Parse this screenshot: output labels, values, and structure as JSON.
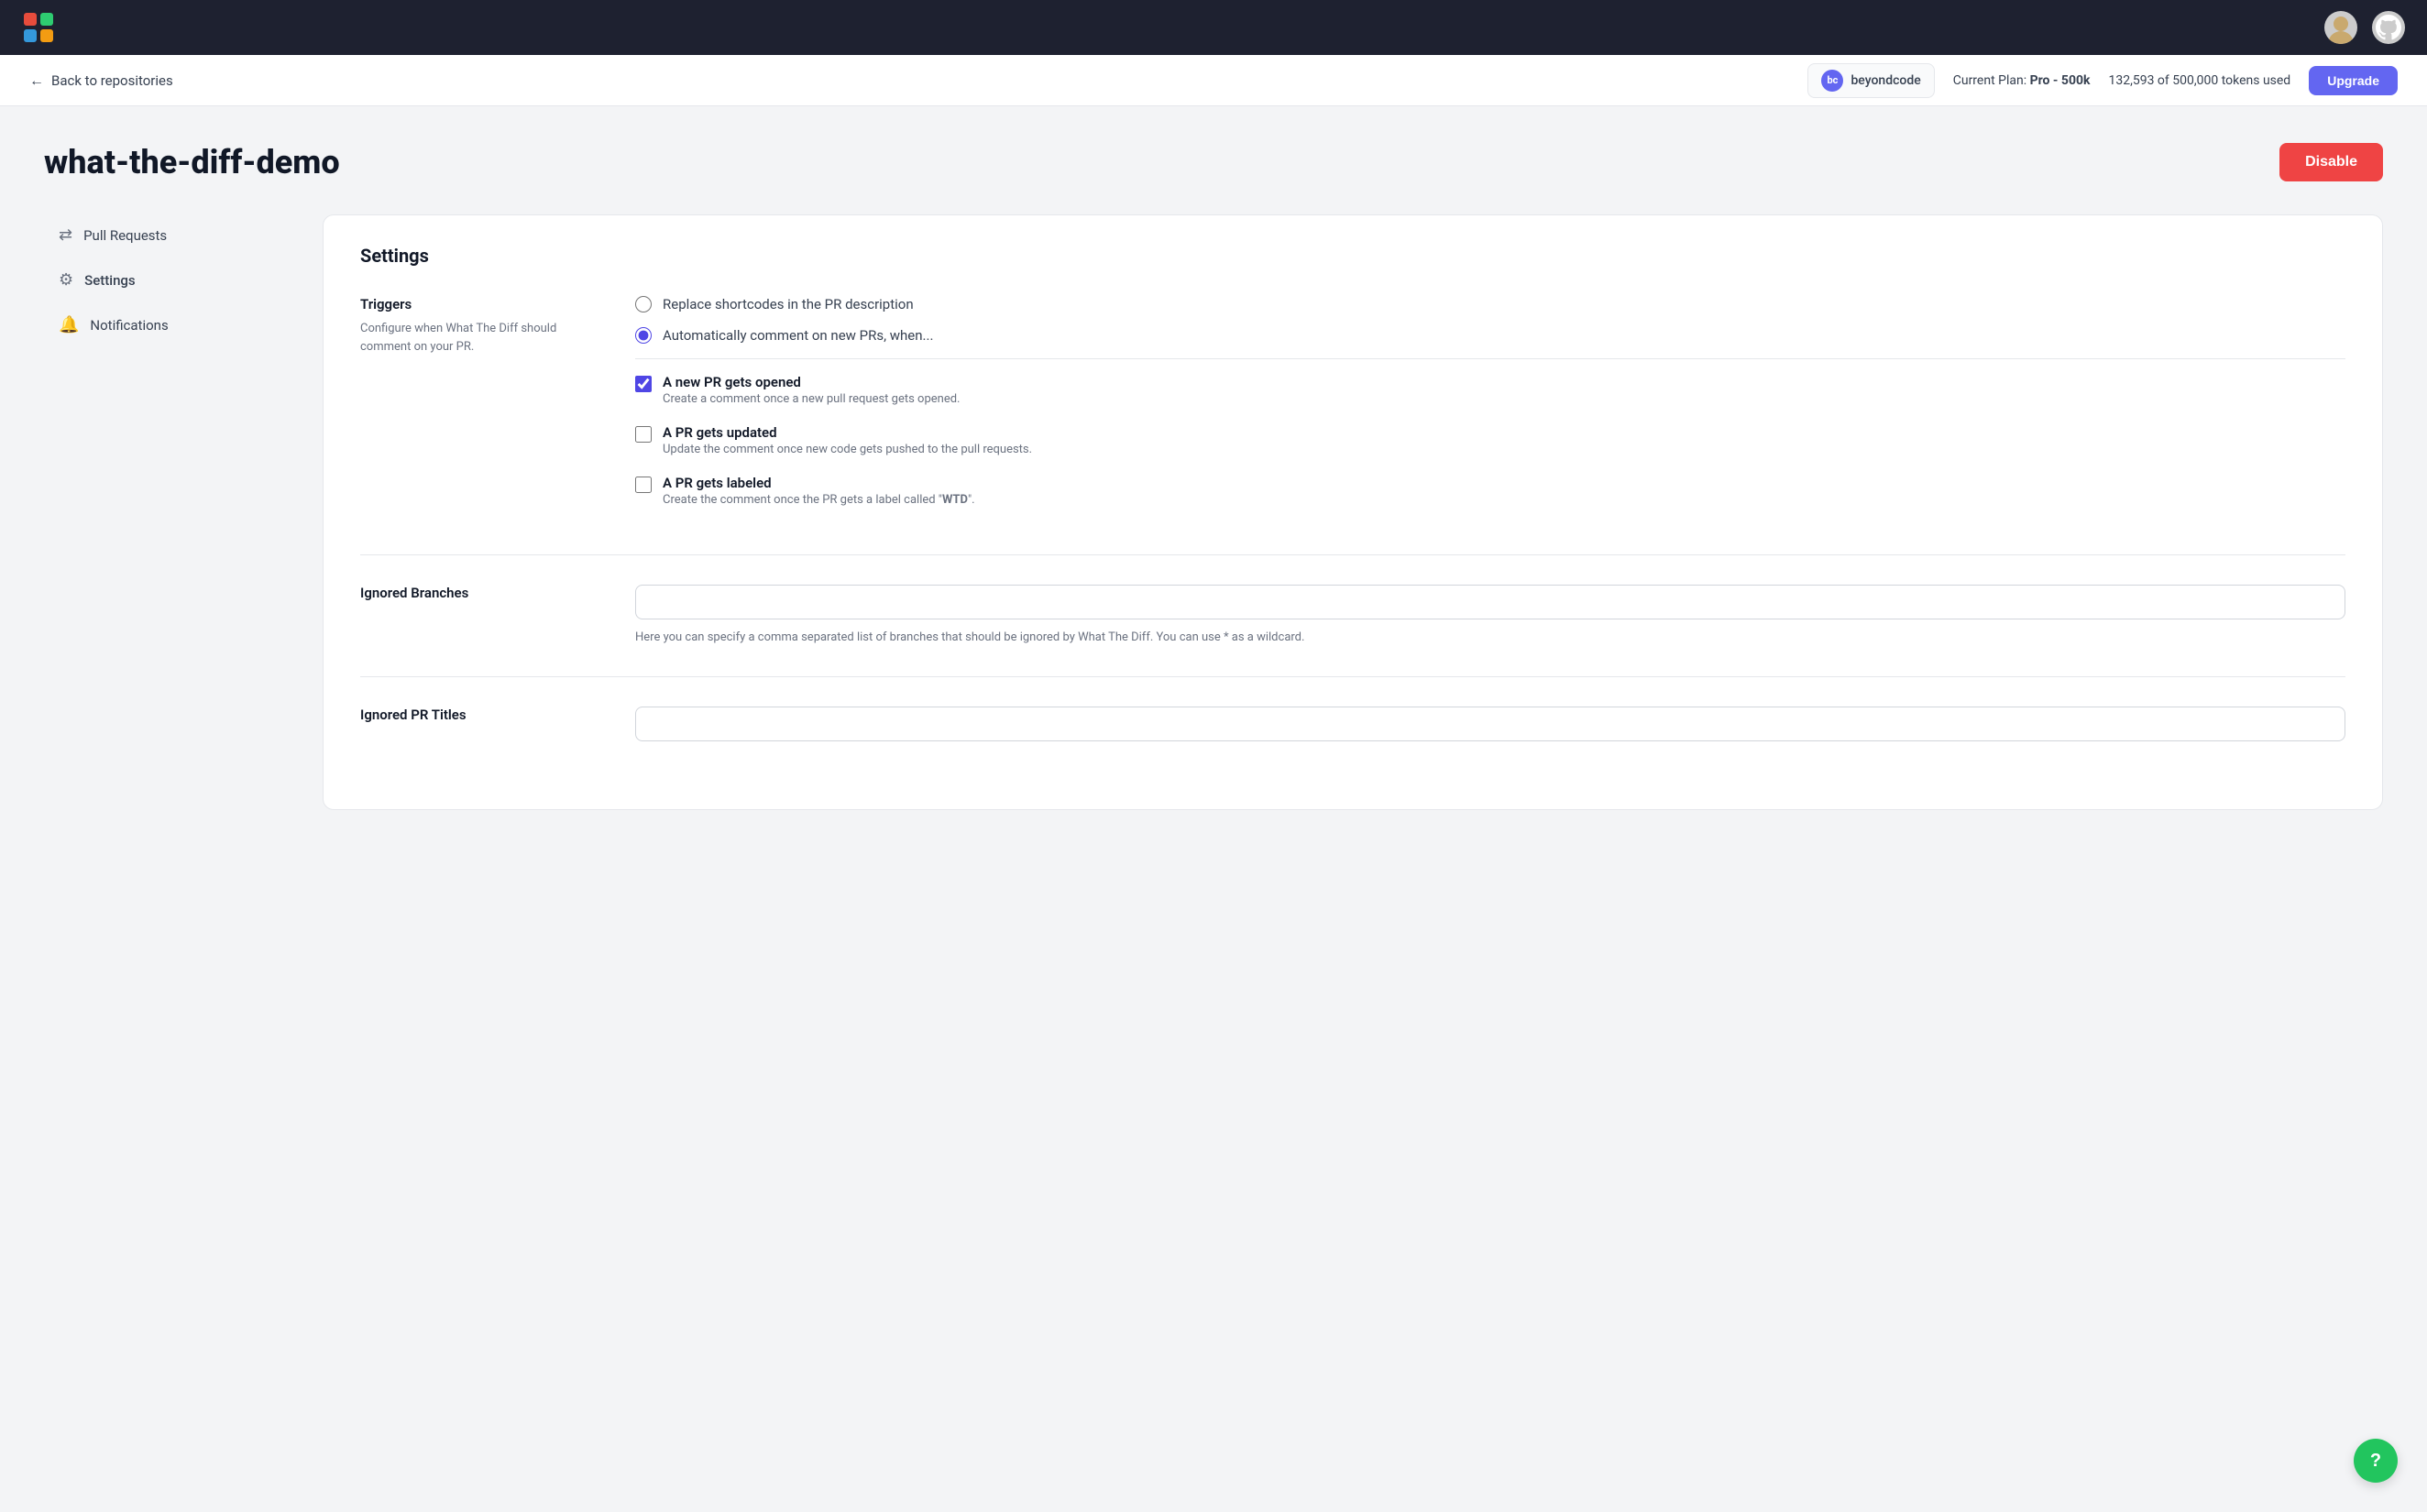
{
  "topbar": {
    "logo_alt": "App Logo"
  },
  "subheader": {
    "back_label": "Back to repositories",
    "org_name": "beyondcode",
    "org_initials": "bc",
    "plan_label": "Current Plan:",
    "plan_name": "Pro - 500k",
    "tokens_used": "132,593 of 500,000 tokens used",
    "upgrade_label": "Upgrade"
  },
  "page": {
    "title": "what-the-diff-demo",
    "disable_label": "Disable"
  },
  "sidebar": {
    "items": [
      {
        "label": "Pull Requests",
        "icon": "⇅",
        "active": false
      },
      {
        "label": "Settings",
        "icon": "⚙",
        "active": true
      },
      {
        "label": "Notifications",
        "icon": "🔔",
        "active": false
      }
    ]
  },
  "settings": {
    "title": "Settings",
    "triggers": {
      "label": "Triggers",
      "description": "Configure when What The Diff should comment on your PR.",
      "option1": {
        "label": "Replace shortcodes in the PR description",
        "checked": false
      },
      "option2": {
        "label": "Automatically comment on new PRs, when...",
        "checked": true
      },
      "checkbox1": {
        "title": "A new PR gets opened",
        "desc": "Create a comment once a new pull request gets opened.",
        "checked": true
      },
      "checkbox2": {
        "title": "A PR gets updated",
        "desc": "Update the comment once new code gets pushed to the pull requests.",
        "checked": false
      },
      "checkbox3": {
        "title": "A PR gets labeled",
        "desc": "Create the comment once the PR gets a label called \"WTD\".",
        "checked": false
      }
    },
    "ignored_branches": {
      "label": "Ignored Branches",
      "placeholder": "",
      "help": "Here you can specify a comma separated list of branches that should be ignored by What The Diff. You can use * as a wildcard."
    },
    "ignored_pr_titles": {
      "label": "Ignored PR Titles",
      "placeholder": ""
    }
  },
  "help_btn": {
    "label": "?"
  }
}
